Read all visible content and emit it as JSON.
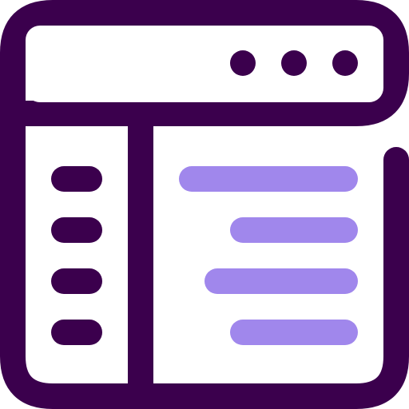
{
  "icon": {
    "name": "web-layout-window-icon",
    "colors": {
      "outline": "#3b004d",
      "accent": "#a087ec",
      "fill": "#ffffff"
    },
    "window_controls": [
      "dot",
      "dot",
      "dot"
    ],
    "sidebar_items": 4,
    "content_lines": 4
  }
}
